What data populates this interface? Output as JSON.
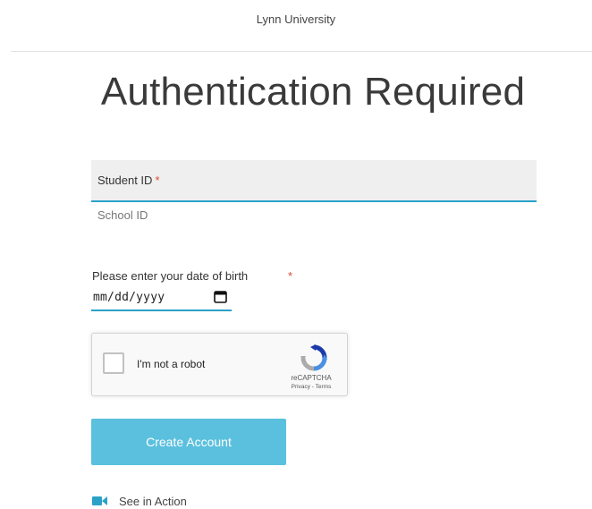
{
  "header": {
    "title": "Lynn University"
  },
  "page": {
    "title": "Authentication Required"
  },
  "form": {
    "student_id": {
      "label": "Student ID",
      "required_mark": "*",
      "helper": "School ID"
    },
    "dob": {
      "label": "Please enter your date of birth",
      "required_mark": "*",
      "value": "mm/dd/yyyy",
      "icon": "calendar-icon"
    },
    "recaptcha": {
      "label": "I'm not a robot",
      "brand": "reCAPTCHA",
      "links": "Privacy - Terms",
      "checked": false
    },
    "submit_label": "Create Account",
    "see_in_action": {
      "label": "See in Action",
      "icon": "video-camera-icon"
    }
  },
  "colors": {
    "accent": "#2aa2c8",
    "button": "#5bc0de",
    "required": "#e2492f",
    "field_bg": "#efefef"
  }
}
